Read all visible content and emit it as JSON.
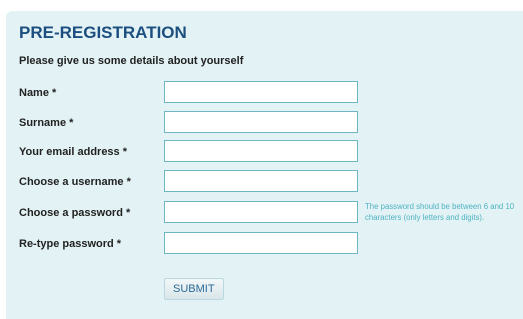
{
  "form": {
    "title": "PRE-REGISTRATION",
    "subtitle": "Please give us some details about yourself",
    "fields": [
      {
        "label": "Name *",
        "value": ""
      },
      {
        "label": "Surname *",
        "value": ""
      },
      {
        "label": "Your email address *",
        "value": ""
      },
      {
        "label": "Choose a username *",
        "value": ""
      },
      {
        "label": "Choose a password *",
        "value": ""
      },
      {
        "label": "Re-type password *",
        "value": ""
      }
    ],
    "password_hint": "The password should be between 6 and 10 characters (only letters and digits).",
    "submit_label": "SUBMIT"
  },
  "colors": {
    "panel_background": "#e3f3f5",
    "title": "#1c4f7f",
    "input_border": "#6fb6c4",
    "hint_text": "#4fb1c3",
    "button_text": "#2a6a9a"
  }
}
